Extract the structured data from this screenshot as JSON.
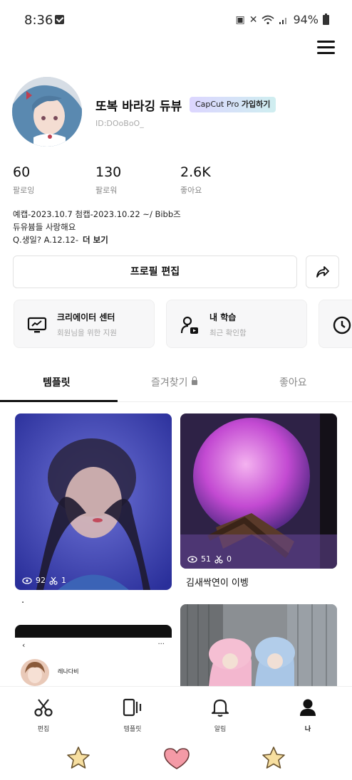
{
  "status": {
    "time": "8:36",
    "battery": "94%"
  },
  "profile": {
    "name": "또복 바라깅 듀뷰",
    "pro_badge_brand": "CapCut Pro",
    "pro_badge_action": "가입하기",
    "id": "ID:DOoBoO_"
  },
  "stats": [
    {
      "value": "60",
      "label": "팔로잉"
    },
    {
      "value": "130",
      "label": "팔로워"
    },
    {
      "value": "2.6K",
      "label": "좋아요"
    }
  ],
  "bio": {
    "line1": "예캡-2023.10.7 첨캡-2023.10.22 ~/ Bibb즈",
    "line2": "듀유븀들 사랑해요",
    "line3": "Q.생일? A.12.12-",
    "more": "더 보기"
  },
  "actions": {
    "edit_profile": "프로필 편집"
  },
  "cards": [
    {
      "title": "크리에이터 센터",
      "subtitle": "회원님을 위한 지원",
      "icon": "monitor-chart-icon"
    },
    {
      "title": "내 학습",
      "subtitle": "최근 확인함",
      "icon": "person-play-icon"
    },
    {
      "title": "",
      "subtitle": "",
      "icon": "clock-icon"
    }
  ],
  "tabs": [
    {
      "label": "템플릿"
    },
    {
      "label": "즐겨찾기"
    },
    {
      "label": "좋아요"
    }
  ],
  "templates": [
    {
      "views": "92",
      "uses": "1",
      "caption": ""
    },
    {
      "views": "51",
      "uses": "0",
      "caption": "김새싹연이 이벵"
    },
    {
      "views": "",
      "uses": "",
      "caption": ".",
      "inner_name": "레나다비"
    },
    {
      "views": "",
      "uses": "",
      "caption": ""
    }
  ],
  "nav": [
    {
      "label": "편집",
      "icon": "scissors-icon"
    },
    {
      "label": "템플릿",
      "icon": "template-icon"
    },
    {
      "label": "알림",
      "icon": "bell-icon"
    },
    {
      "label": "나",
      "icon": "person-icon"
    }
  ],
  "colors": {
    "accent": "#111111",
    "badge_start": "#dcd6ff",
    "badge_end": "#cfeef0",
    "star": "#f7dfa0",
    "heart": "#f49aa6"
  }
}
